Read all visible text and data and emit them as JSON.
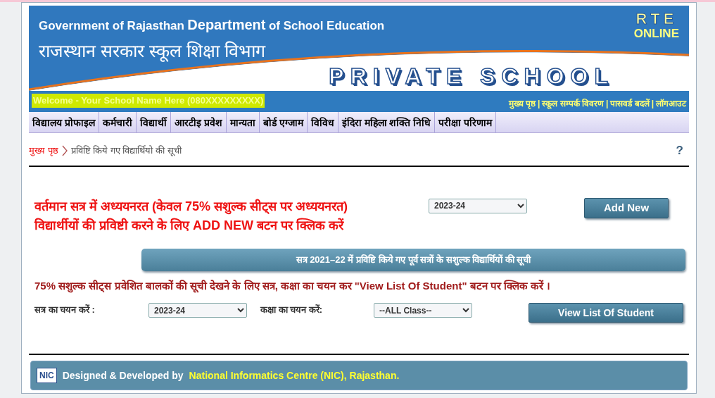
{
  "header": {
    "title_parts": [
      {
        "text": "Government of Rajasthan",
        "kind": "normal"
      },
      {
        "text": "Department",
        "kind": "large"
      },
      {
        "text": "of School Education",
        "kind": "normal"
      }
    ],
    "subtitle": "राजस्थान सरकार स्कूल शिक्षा विभाग",
    "rte": "RTE",
    "online": "ONLINE",
    "section": "PRIVATE SCHOOL"
  },
  "welcome": "Welcome - Your School Name Here (080XXXXXXXXX)",
  "top_links": {
    "separator": "|",
    "items": [
      "मुख्य पृष्ठ",
      "स्कूल सम्पर्क विवरण",
      "पासवर्ड बदलें",
      "लॉगआउट"
    ]
  },
  "menu": [
    "विद्यालय प्रोफाइल",
    "कर्मचारी",
    "विद्यार्थी",
    "आरटीइ प्रवेश",
    "मान्यता",
    "बोर्ड एग्जाम",
    "विविध",
    "इंदिरा महिला शक्ति निधि",
    "परीक्षा परिणाम"
  ],
  "breadcrumb": {
    "home": "मुख्य पृष्ठ",
    "current": "प्रविष्टि किये गए विद्यार्थियो की सूची",
    "help": "?"
  },
  "add_section": {
    "lines": [
      "वर्तमान सत्र में अध्ययनरत (केवल 75% सशुल्क सीट्स पर अध्ययनरत)",
      "विद्यार्थीयों की प्रविष्टी करने के लिए ADD NEW बटन पर क्लिक करें"
    ],
    "session": "2023-24",
    "button": "Add New"
  },
  "list_section": {
    "heading": "सत्र 2021–22 में प्रविष्टि किये गए पूर्व सत्रों के सशुल्क विद्यार्थियों की सूची",
    "instruction": "75% सशुल्क सीट्स प्रवेशित बालकों की सूची देखने के लिए सत्र, कक्षा का चयन कर \"View List Of Student\" बटन पर क्लिक करें ।",
    "session_label": "सत्र का चयन करें :",
    "session": "2023-24",
    "class_label": "कक्षा का चयन करें:",
    "class": "--ALL Class--",
    "button": "View List Of Student"
  },
  "footer": {
    "logo": "NIC",
    "prefix": "Designed & Developed by",
    "org": "National Informatics Centre (NIC), Rajasthan."
  }
}
